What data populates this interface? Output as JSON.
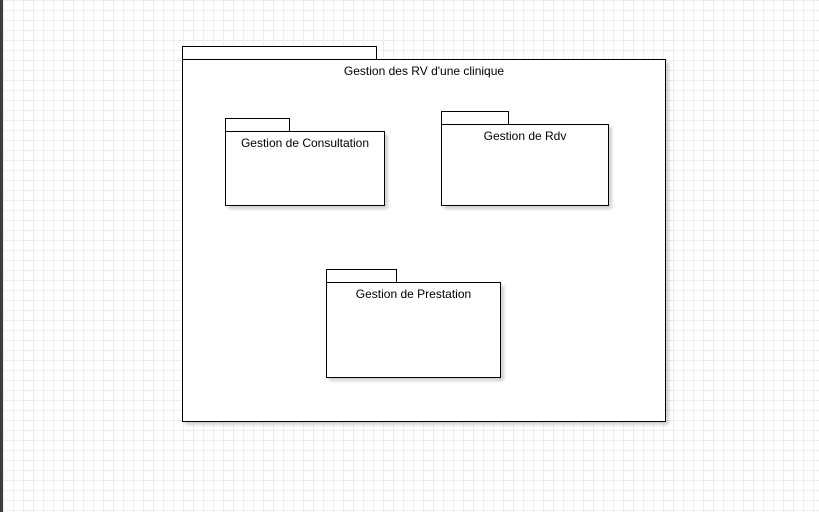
{
  "diagram": {
    "outer_package": {
      "title": "Gestion des RV d'une clinique"
    },
    "packages": [
      {
        "title": "Gestion de Consultation"
      },
      {
        "title": "Gestion de Rdv"
      },
      {
        "title": "Gestion de Prestation"
      }
    ]
  },
  "colors": {
    "background": "#ffffff",
    "grid": "#ececec",
    "stroke": "#000000",
    "sidebar": "#3a3d41"
  }
}
